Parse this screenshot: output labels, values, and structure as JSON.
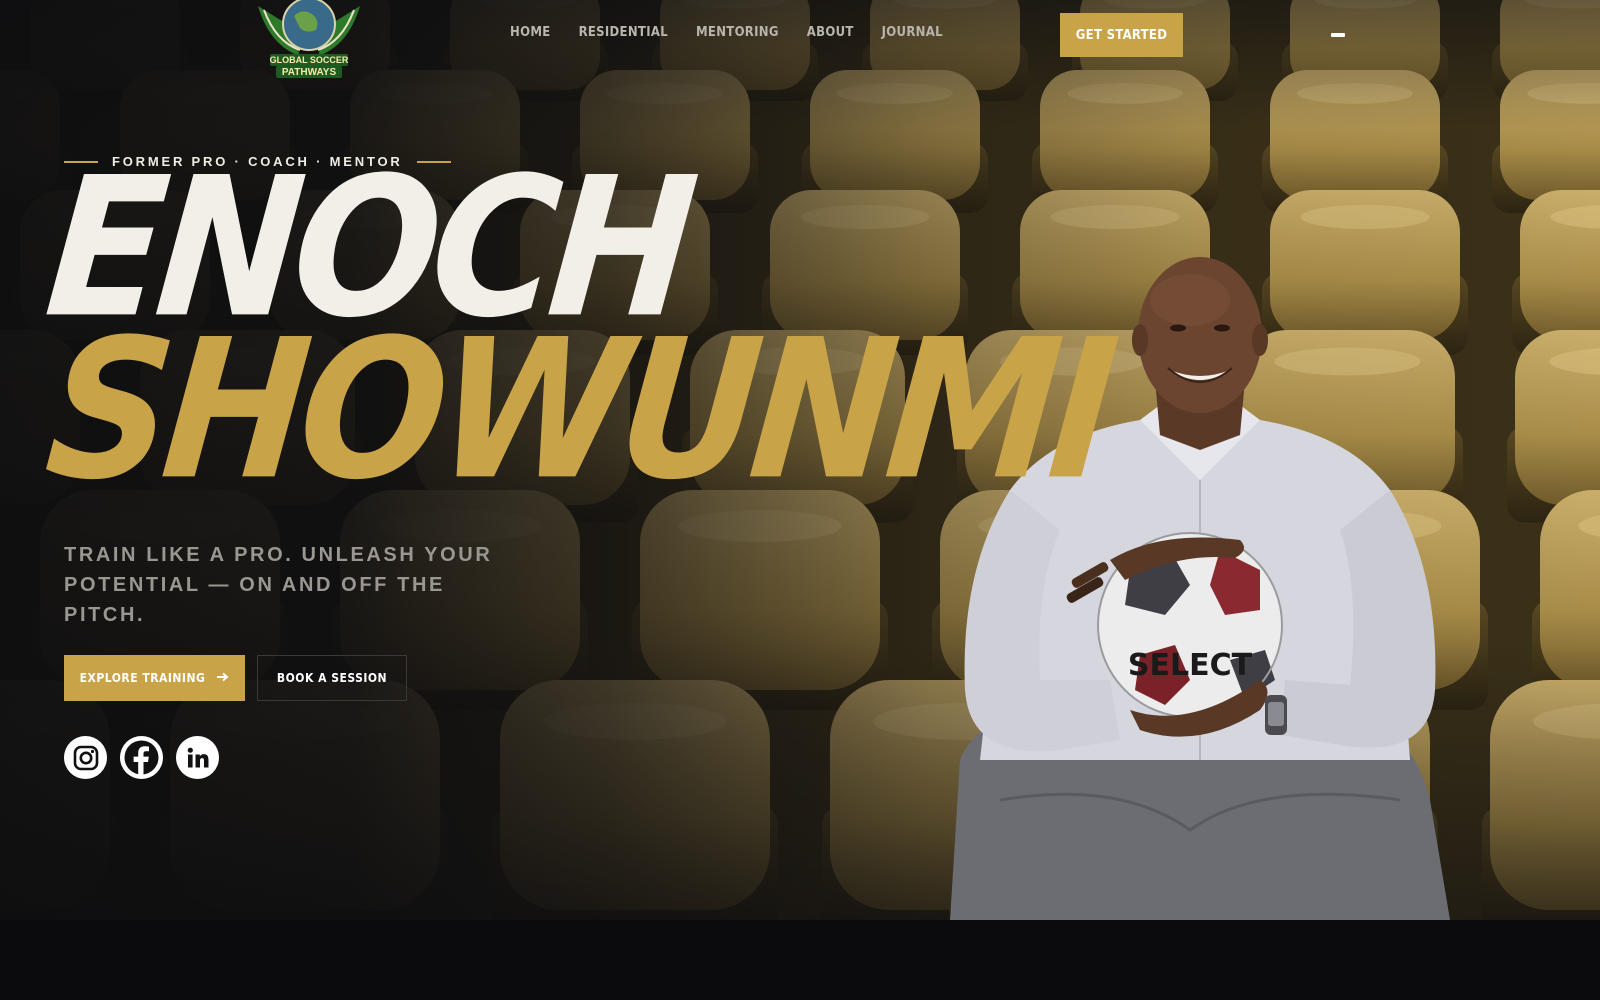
{
  "brand": {
    "logo_name": "GLOBAL SOCCER PATHWAYS",
    "logo_line_1": "GLOBAL SOCCER",
    "logo_line_2": "PATHWAYS",
    "accent_color": "#c9a348"
  },
  "nav": {
    "items": [
      {
        "label": "HOME"
      },
      {
        "label": "RESIDENTIAL"
      },
      {
        "label": "MENTORING"
      },
      {
        "label": "ABOUT"
      },
      {
        "label": "JOURNAL"
      }
    ],
    "cta_label": "GET STARTED",
    "menu_icon": "menu-icon"
  },
  "hero": {
    "eyebrow": "FORMER PRO · COACH · MENTOR",
    "first_name": "ENOCH",
    "last_name": "SHOWUNMI",
    "tagline": "TRAIN LIKE A PRO. UNLEASH YOUR POTENTIAL — ON AND OFF THE PITCH.",
    "primary_button": "EXPLORE TRAINING",
    "primary_button_icon": "arrow-right-icon",
    "secondary_button": "BOOK A SESSION",
    "ball_brand": "SELECT"
  },
  "socials": [
    {
      "icon": "instagram-icon"
    },
    {
      "icon": "facebook-icon"
    },
    {
      "icon": "linkedin-icon"
    }
  ]
}
